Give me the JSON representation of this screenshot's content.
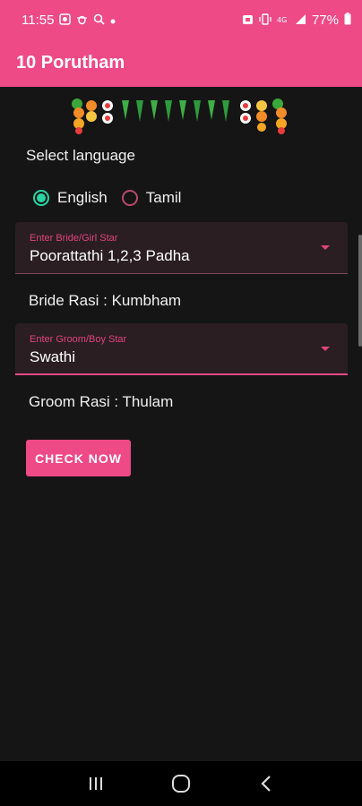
{
  "status_bar": {
    "time": "11:55",
    "battery": "77%",
    "left_icons": [
      "gallery-icon",
      "bug-icon",
      "search-icon",
      "dot-icon"
    ],
    "right_icons": [
      "alarm-icon",
      "vibrate-icon",
      "volte-icon",
      "signal-icon",
      "battery-icon"
    ]
  },
  "app_bar": {
    "title": "10 Porutham"
  },
  "language": {
    "label": "Select language",
    "options": [
      {
        "label": "English",
        "selected": true
      },
      {
        "label": "Tamil",
        "selected": false
      }
    ]
  },
  "bride_star": {
    "label": "Enter Bride/Girl Star",
    "value": "Poorattathi 1,2,3 Padha"
  },
  "bride_rasi": "Bride Rasi : Kumbham",
  "groom_star": {
    "label": "Enter Groom/Boy Star",
    "value": "Swathi"
  },
  "groom_rasi": "Groom Rasi : Thulam",
  "check_button": {
    "label": "CHECK NOW"
  },
  "colors": {
    "primary": "#ee4a85",
    "accent_radio": "#2bd4a4",
    "background": "#151515",
    "field_bg": "#2a1e22"
  }
}
